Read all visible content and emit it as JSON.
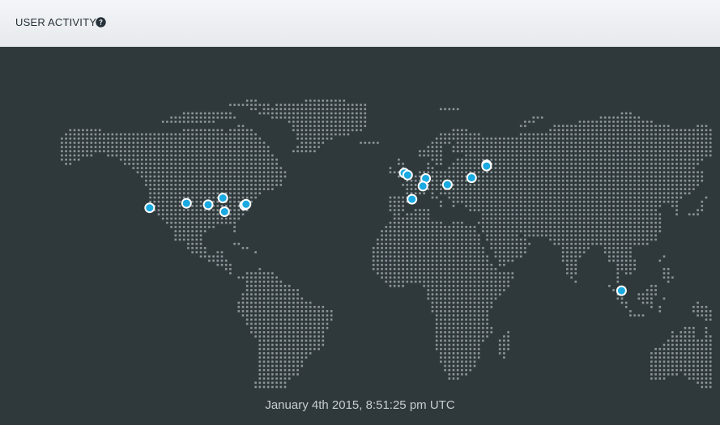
{
  "header": {
    "title": "USER ACTIVITY",
    "help_icon": "question-circle-icon"
  },
  "map": {
    "land_dot_color": "#8d9599",
    "background_color": "#2f393c",
    "marker_fill": "#1aa9e0",
    "marker_stroke": "#ffffff",
    "markers": [
      {
        "region": "california",
        "lon": -122.4,
        "lat": 37.8
      },
      {
        "region": "colorado",
        "lon": -104.9,
        "lat": 39.7
      },
      {
        "region": "missouri",
        "lon": -94.6,
        "lat": 39.1
      },
      {
        "region": "illinois",
        "lon": -87.6,
        "lat": 41.9
      },
      {
        "region": "tennessee",
        "lon": -86.8,
        "lat": 36.2
      },
      {
        "region": "virginia",
        "lon": -77.4,
        "lat": 38.9
      },
      {
        "region": "maryland",
        "lon": -76.6,
        "lat": 39.3
      },
      {
        "region": "uk-south",
        "lon": -1.5,
        "lat": 52.4
      },
      {
        "region": "uk-london",
        "lon": 0.1,
        "lat": 51.5
      },
      {
        "region": "germany",
        "lon": 8.7,
        "lat": 50.1
      },
      {
        "region": "switzerland",
        "lon": 7.4,
        "lat": 46.9
      },
      {
        "region": "spain",
        "lon": 2.2,
        "lat": 41.4
      },
      {
        "region": "hungary",
        "lon": 19.0,
        "lat": 47.5
      },
      {
        "region": "ukraine",
        "lon": 30.5,
        "lat": 50.4
      },
      {
        "region": "moscow-1",
        "lon": 37.6,
        "lat": 55.8
      },
      {
        "region": "moscow-2",
        "lon": 37.6,
        "lat": 55.3
      },
      {
        "region": "malaysia",
        "lon": 101.7,
        "lat": 3.1
      }
    ]
  },
  "footer": {
    "timestamp": "January 4th 2015, 8:51:25 pm UTC"
  }
}
